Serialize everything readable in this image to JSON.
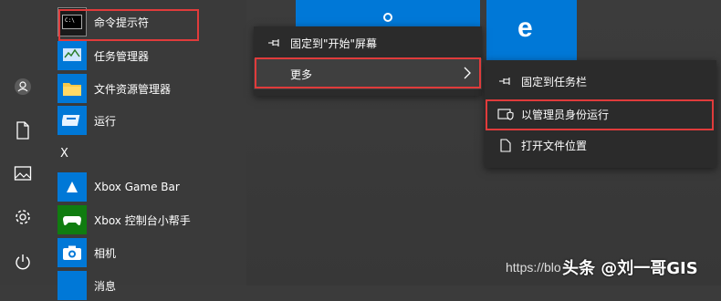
{
  "apps": [
    {
      "label": "命令提示符",
      "icon": "cmd-icon"
    },
    {
      "label": "任务管理器",
      "icon": "task-manager-icon"
    },
    {
      "label": "文件资源管理器",
      "icon": "folder-icon"
    },
    {
      "label": "运行",
      "icon": "run-icon"
    }
  ],
  "section_letter": "X",
  "apps_x": [
    {
      "label": "Xbox Game Bar",
      "icon": "xbox-game-bar-icon"
    },
    {
      "label": "Xbox 控制台小帮手",
      "icon": "xbox-console-icon"
    },
    {
      "label": "相机",
      "icon": "camera-icon"
    },
    {
      "label": "消息",
      "icon": "messages-icon"
    }
  ],
  "context_menu": {
    "pin_start": "固定到\"开始\"屏幕",
    "more": "更多"
  },
  "submenu": {
    "pin_taskbar": "固定到任务栏",
    "run_as_admin": "以管理员身份运行",
    "open_location": "打开文件位置"
  },
  "watermark": {
    "url": "https://blo",
    "brand": "头条 @刘一哥GIS"
  },
  "colors": {
    "accent": "#0078d7",
    "highlight": "#e03b3b",
    "menu_bg": "#2b2b2b"
  }
}
